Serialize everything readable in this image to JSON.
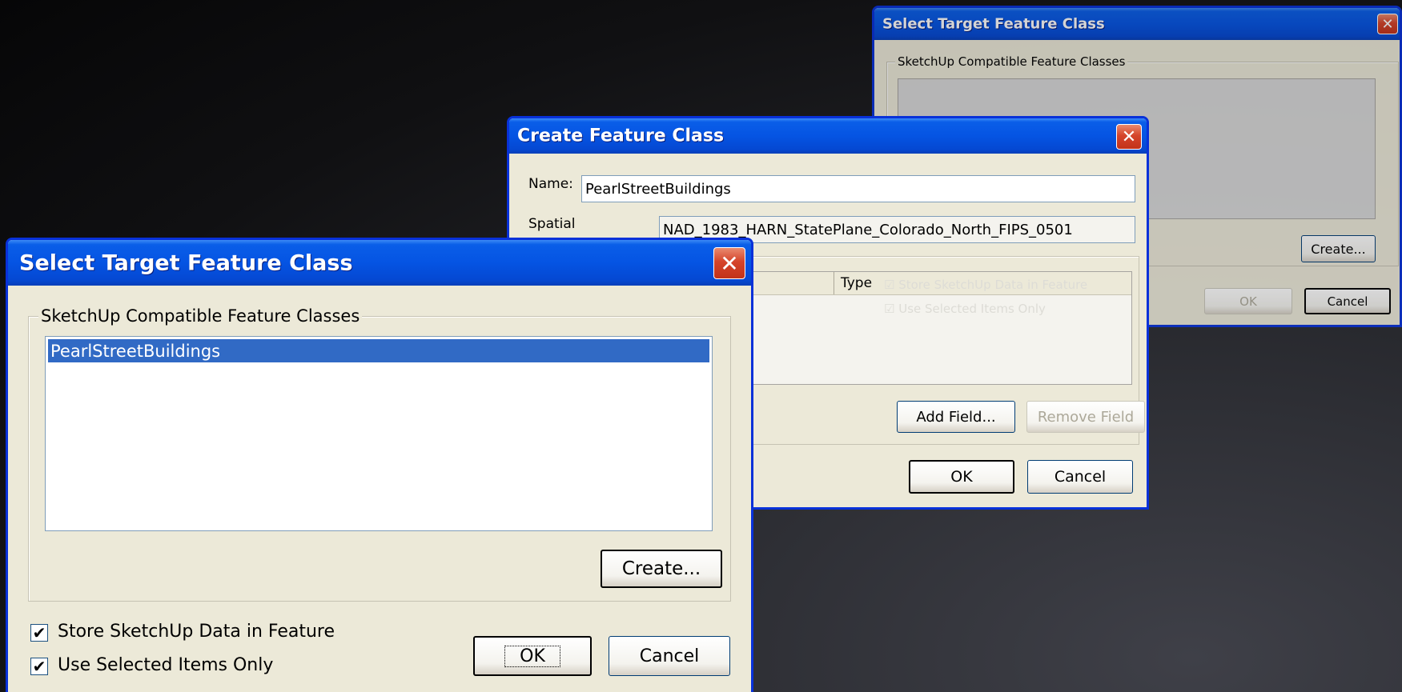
{
  "back_dialog": {
    "title": "Select Target Feature Class",
    "group_label": "SketchUp Compatible Feature Classes",
    "create_label": "Create...",
    "store_label": "Store SketchUp Data in Feature",
    "use_selected_label": "Use Selected Items Only",
    "ok_label": "OK",
    "cancel_label": "Cancel"
  },
  "create_dialog": {
    "title": "Create Feature Class",
    "name_label": "Name:",
    "name_value": "PearlStreetBuildings",
    "spatial_label": "Spatial",
    "spatial_value": "NAD_1983_HARN_StatePlane_Colorado_North_FIPS_0501",
    "type_header": "Type",
    "add_field_label": "Add Field...",
    "remove_field_label": "Remove Field",
    "ok_label": "OK",
    "cancel_label": "Cancel"
  },
  "front_dialog": {
    "title": "Select Target Feature Class",
    "group_label": "SketchUp Compatible Feature Classes",
    "list_items": [
      "PearlStreetBuildings"
    ],
    "create_label": "Create...",
    "store_label": "Store SketchUp Data in Feature",
    "use_selected_label": "Use Selected Items Only",
    "store_checked": true,
    "use_selected_checked": true,
    "ok_label": "OK",
    "cancel_label": "Cancel"
  }
}
